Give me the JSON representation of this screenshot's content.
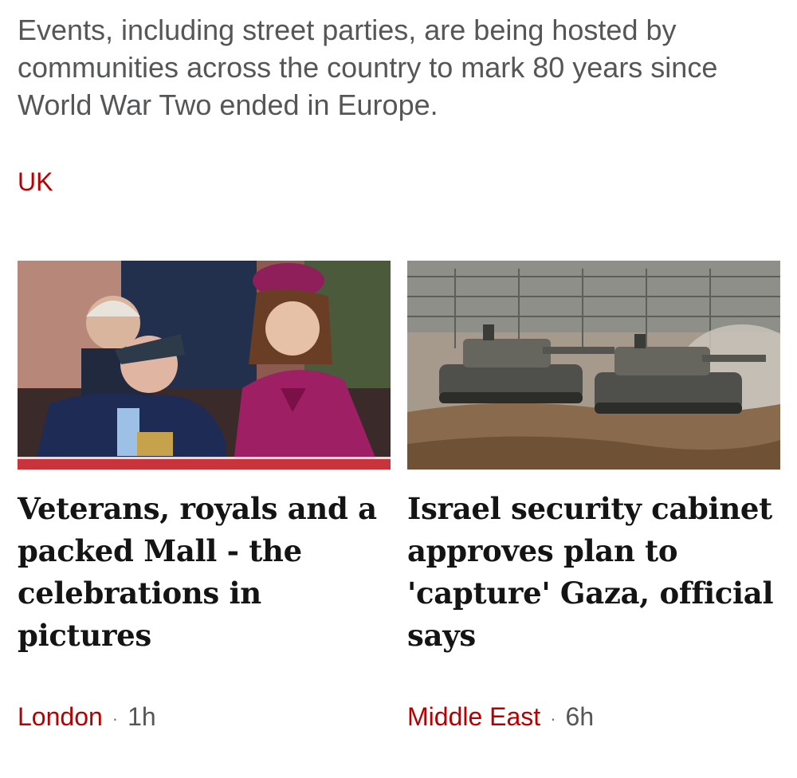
{
  "summary": {
    "text": "Events, including street parties, are being hosted by communities across the country to mark 80 years since World War Two ended in Europe."
  },
  "topic": {
    "label": "UK"
  },
  "cards": [
    {
      "headline": "Veterans, royals and a packed Mall - the celebrations in pictures",
      "location": "London",
      "separator": "·",
      "time": "1h",
      "image_description": "veterans-and-royal-photo"
    },
    {
      "headline": "Israel security cabinet approves plan to 'capture' Gaza, official says",
      "location": "Middle East",
      "separator": "·",
      "time": "6h",
      "image_description": "tanks-photo"
    }
  ],
  "colors": {
    "accent_red": "#b80000",
    "summary_grey": "#545658",
    "headline_black": "#141414"
  }
}
